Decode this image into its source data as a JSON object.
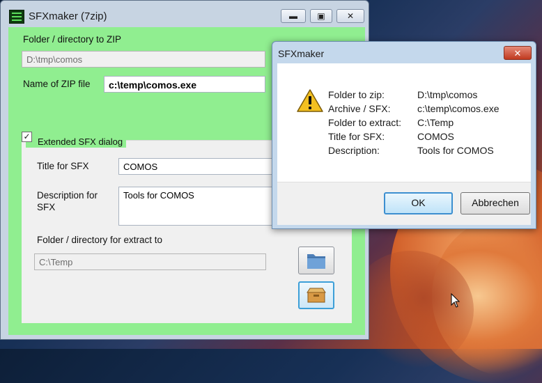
{
  "main_window": {
    "title": "SFXmaker (7zip)",
    "caption_buttons": [
      "minimize",
      "maximize",
      "close"
    ],
    "folder_label": "Folder / directory to ZIP",
    "folder_value": "D:\\tmp\\comos",
    "zip_name_label": "Name of ZIP file",
    "zip_name_value": "c:\\temp\\comos.exe",
    "extended_checkbox_label": "Extended SFX dialog",
    "extended_checked": true,
    "title_sfx_label": "Title for SFX",
    "title_sfx_value": "COMOS",
    "description_label": "Description for SFX",
    "description_value": "Tools for COMOS",
    "extract_folder_label": "Folder / directory for extract to",
    "extract_folder_value": "C:\\Temp",
    "buttons": {
      "browse_icon": "folder-icon",
      "create_icon": "box-icon"
    },
    "background_color": "#90ee90"
  },
  "message_box": {
    "title": "SFXmaker",
    "icon": "warning-icon",
    "rows": [
      {
        "label": "Folder to zip:",
        "value": "D:\\tmp\\comos"
      },
      {
        "label": "Archive / SFX:",
        "value": "c:\\temp\\comos.exe"
      },
      {
        "label": "Folder to extract:",
        "value": "C:\\Temp"
      },
      {
        "label": "Title for SFX:",
        "value": "COMOS"
      },
      {
        "label": "Description:",
        "value": "Tools for COMOS"
      }
    ],
    "ok_label": "OK",
    "cancel_label": "Abbrechen"
  }
}
